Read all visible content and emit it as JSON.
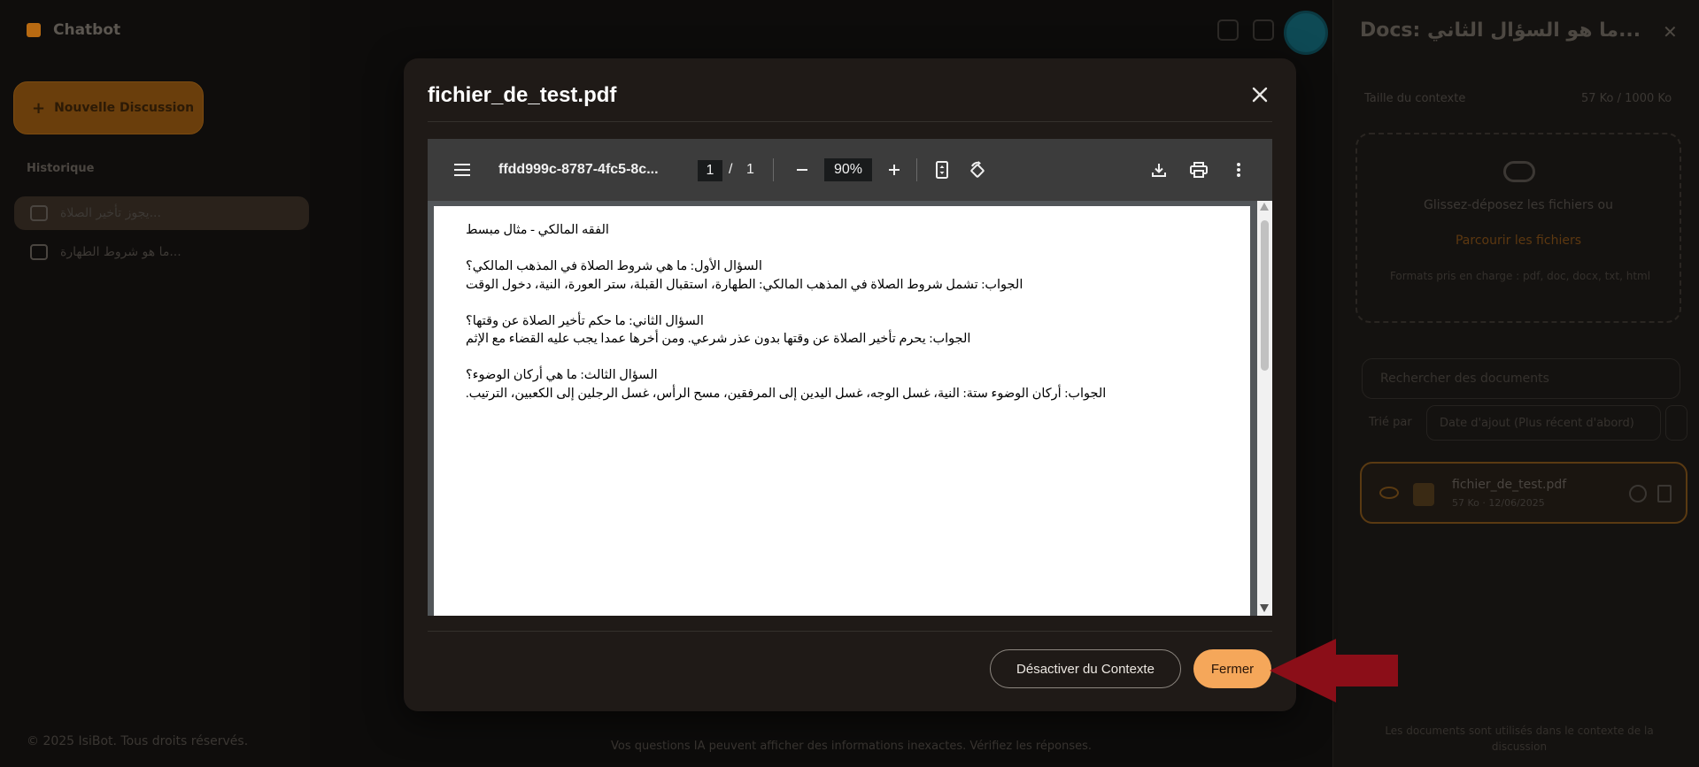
{
  "background": {
    "brand_name": "Chatbot",
    "new_chat_label": "Nouvelle Discussion",
    "history_title": "Historique",
    "history_items": [
      "يجوز تأخير الصلاة...",
      "ما هو شروط الطهارة..."
    ],
    "footer_copy": "© 2025 IsiBot. Tous droits réservés.",
    "bottom_note": "Vos questions IA peuvent afficher des informations inexactes. Vérifiez les réponses.",
    "right_panel": {
      "title": "Docs: ما هو السؤال الثاني...",
      "context_label": "Taille du contexte",
      "context_size": "57 Ko / 1000 Ko",
      "dropzone_text": "Glissez-déposez les fichiers ou",
      "dropzone_link": "Parcourir les fichiers",
      "dropzone_hint": "Formats pris en charge : pdf, doc, docx, txt, html",
      "search_placeholder": "Rechercher des documents",
      "sort_label": "Trié par",
      "sort_value": "Date d'ajout (Plus récent d'abord)",
      "file_name": "fichier_de_test.pdf",
      "file_meta": "57 Ko · 12/06/2025",
      "footer": "Les documents sont utilisés dans le contexte de la discussion"
    }
  },
  "modal": {
    "title": "fichier_de_test.pdf",
    "close_icon": "close-icon",
    "viewer": {
      "doc_name": "ffdd999c-8787-4fc5-8c...",
      "page_current": "1",
      "page_separator": "/",
      "page_total": "1",
      "zoom": "90%",
      "lines": [
        "الفقه المالكي - مثال مبسط",
        "",
        "السؤال الأول: ما هي شروط الصلاة في المذهب المالكي؟",
        "الجواب: تشمل شروط الصلاة في المذهب المالكي: الطهارة، استقبال القبلة، ستر العورة، النية، دخول الوقت",
        "",
        "السؤال الثاني: ما حكم تأخير الصلاة عن وقتها؟",
        "الجواب: يحرم تأخير الصلاة عن وقتها بدون عذر شرعي. ومن أخرها عمدا يجب عليه القضاء مع الإثم",
        "",
        "السؤال الثالث: ما هي أركان الوضوء؟",
        "الجواب: أركان الوضوء ستة: النية، غسل الوجه، غسل اليدين إلى المرفقين، مسح الرأس، غسل الرجلين إلى الكعبين، الترتيب."
      ]
    },
    "buttons": {
      "deactivate": "Désactiver du Contexte",
      "close": "Fermer"
    }
  },
  "colors": {
    "accent": "#f5a75a",
    "modal_bg": "#1f1a17",
    "annotation": "#8b0e18"
  }
}
